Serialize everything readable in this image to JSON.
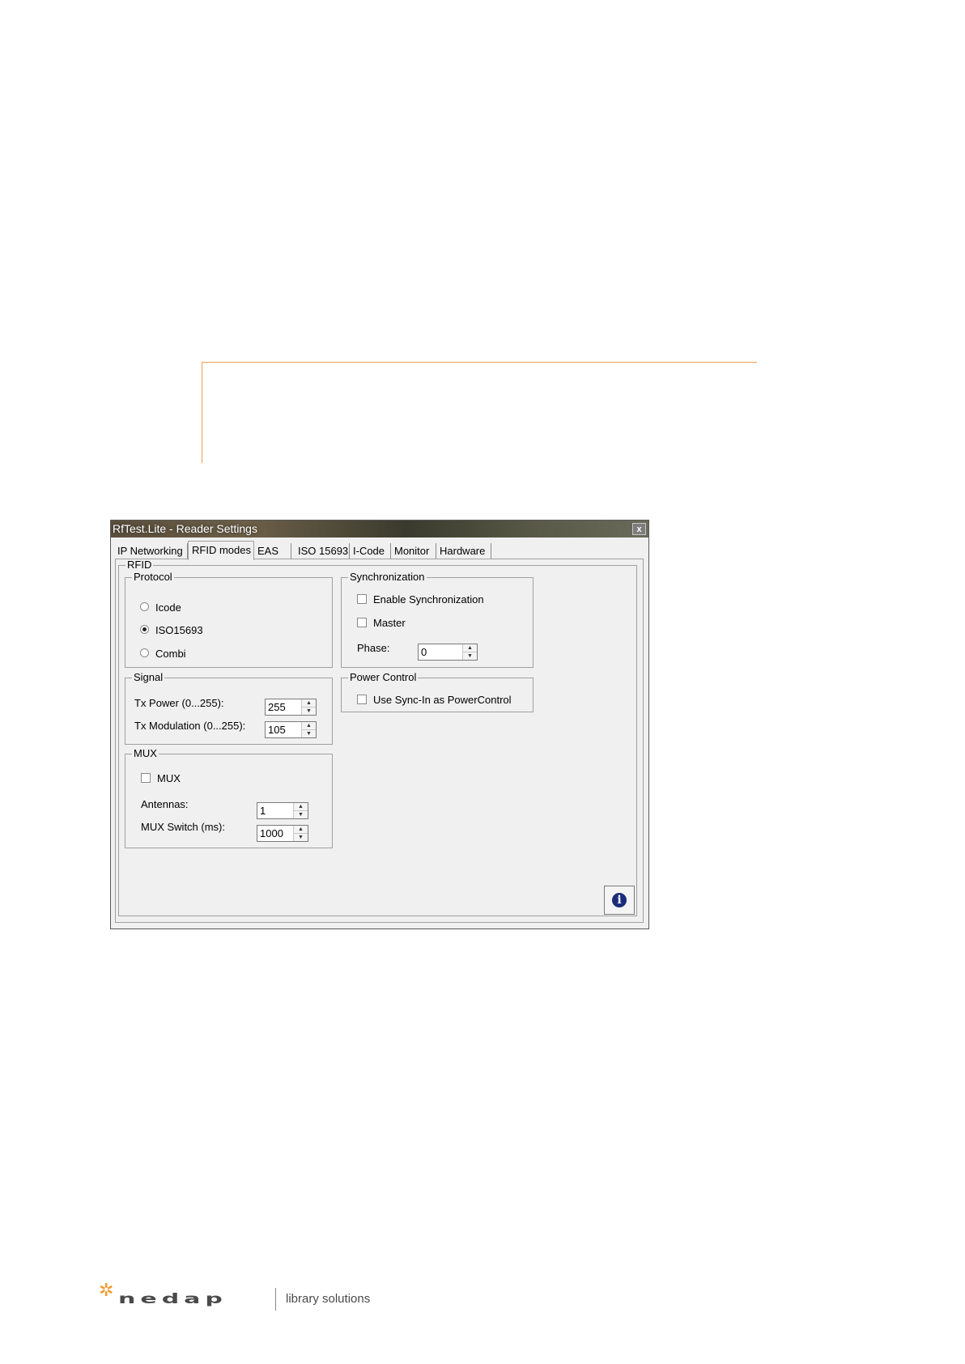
{
  "window": {
    "title": "RfTest.Lite - Reader Settings",
    "close_label": "x"
  },
  "tabs": [
    {
      "label": "IP Networking",
      "active": false
    },
    {
      "label": "RFID modes",
      "active": true
    },
    {
      "label": "EAS",
      "active": false
    },
    {
      "label": "ISO 15693",
      "active": false
    },
    {
      "label": "I-Code",
      "active": false
    },
    {
      "label": "Monitor",
      "active": false
    },
    {
      "label": "Hardware",
      "active": false
    }
  ],
  "rfid": {
    "legend": "RFID",
    "protocol": {
      "legend": "Protocol",
      "options": [
        {
          "label": "Icode",
          "selected": false
        },
        {
          "label": "ISO15693",
          "selected": true
        },
        {
          "label": "Combi",
          "selected": false
        }
      ]
    },
    "signal": {
      "legend": "Signal",
      "tx_power_label": "Tx Power (0...255):",
      "tx_power_value": "255",
      "tx_mod_label": "Tx Modulation (0...255):",
      "tx_mod_value": "105"
    },
    "mux": {
      "legend": "MUX",
      "mux_checkbox_label": "MUX",
      "mux_checked": false,
      "antennas_label": "Antennas:",
      "antennas_value": "1",
      "switch_label": "MUX Switch (ms):",
      "switch_value": "1000"
    },
    "sync": {
      "legend": "Synchronization",
      "enable_label": "Enable Synchronization",
      "enable_checked": false,
      "master_label": "Master",
      "master_checked": false,
      "phase_label": "Phase:",
      "phase_value": "0"
    },
    "power": {
      "legend": "Power Control",
      "sync_in_label": "Use Sync-In as PowerControl",
      "sync_in_checked": false
    }
  },
  "footer": {
    "brand": "nedap",
    "tagline": "library solutions"
  },
  "colors": {
    "accent_line": "#f0a050",
    "logo_star": "#f39b2d",
    "info_icon": "#1a2c7a"
  }
}
